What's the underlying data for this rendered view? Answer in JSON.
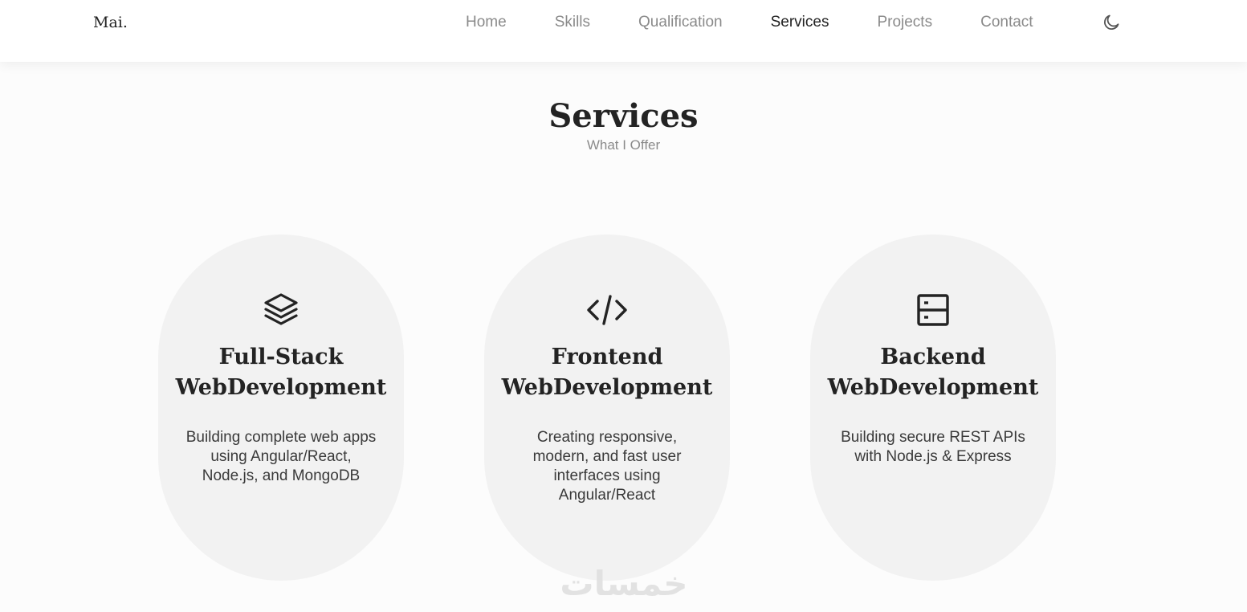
{
  "header": {
    "logo": "Mai.",
    "nav": [
      {
        "label": "Home"
      },
      {
        "label": "Skills"
      },
      {
        "label": "Qualification"
      },
      {
        "label": "Services"
      },
      {
        "label": "Projects"
      },
      {
        "label": "Contact"
      }
    ],
    "active_item": "Services",
    "theme_toggle_icon": "moon-icon"
  },
  "section": {
    "title": "Services",
    "subtitle": "What I Offer"
  },
  "cards": [
    {
      "icon": "layers-icon",
      "title_line1": "Full-Stack",
      "title_line2": "WebDevelopment",
      "description": "Building complete web apps using Angular/React, Node.js, and MongoDB"
    },
    {
      "icon": "code-icon",
      "title_line1": "Frontend",
      "title_line2": "WebDevelopment",
      "description": "Creating responsive, modern, and fast user interfaces using Angular/React"
    },
    {
      "icon": "server-icon",
      "title_line1": "Backend",
      "title_line2": "WebDevelopment",
      "description": "Building secure REST APIs with Node.js & Express"
    }
  ],
  "watermark": "خمسات",
  "colors": {
    "background": "#fcfcfc",
    "card": "#f2f2f2",
    "text_dark": "#232323",
    "text_muted": "#8a8a8a"
  }
}
